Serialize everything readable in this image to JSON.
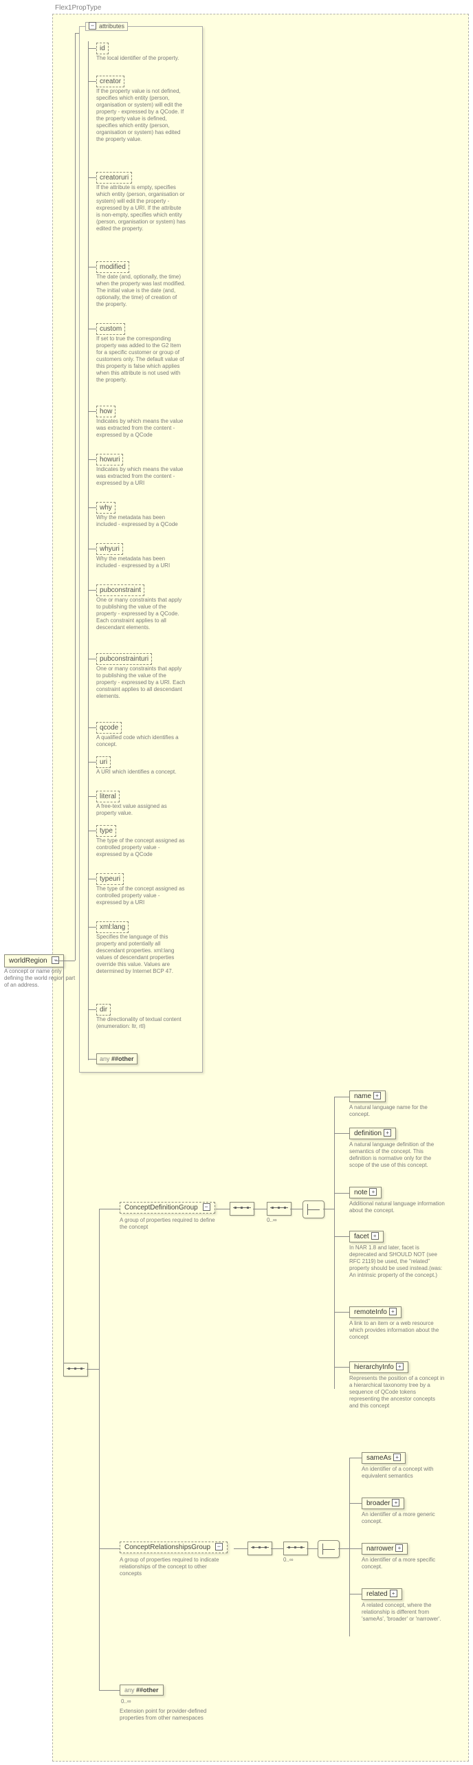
{
  "typeLabel": "Flex1PropType",
  "rootElement": {
    "name": "worldRegion",
    "desc": "A concept or name only defining the world region part of an address."
  },
  "attributesLabel": "attributes",
  "attributes": [
    {
      "name": "id",
      "desc": "The local identifier of the property."
    },
    {
      "name": "creator",
      "desc": "If the property value is not defined, specifies which entity (person, organisation or system) will edit the property - expressed by a QCode. If the property value is defined, specifies which entity (person, organisation or system) has edited the property value."
    },
    {
      "name": "creatoruri",
      "desc": "If the attribute is empty, specifies which entity (person, organisation or system) will edit the property - expressed by a URI. If the attribute is non-empty, specifies which entity (person, organisation or system) has edited the property."
    },
    {
      "name": "modified",
      "desc": "The date (and, optionally, the time) when the property was last modified. The initial value is the date (and, optionally, the time) of creation of the property."
    },
    {
      "name": "custom",
      "desc": "If set to true the corresponding property was added to the G2 Item for a specific customer or group of customers only. The default value of this property is false which applies when this attribute is not used with the property."
    },
    {
      "name": "how",
      "desc": "Indicates by which means the value was extracted from the content - expressed by a QCode"
    },
    {
      "name": "howuri",
      "desc": "Indicates by which means the value was extracted from the content - expressed by a URI"
    },
    {
      "name": "why",
      "desc": "Why the metadata has been included - expressed by a QCode"
    },
    {
      "name": "whyuri",
      "desc": "Why the metadata has been included - expressed by a URI"
    },
    {
      "name": "pubconstraint",
      "desc": "One or many constraints that apply to publishing the value of the property - expressed by a QCode. Each constraint applies to all descendant elements."
    },
    {
      "name": "pubconstrainturi",
      "desc": "One or many constraints that apply to publishing the value of the property - expressed by a URI. Each constraint applies to all descendant elements."
    },
    {
      "name": "qcode",
      "desc": "A qualified code which identifies a concept."
    },
    {
      "name": "uri",
      "desc": "A URI which identifies a concept."
    },
    {
      "name": "literal",
      "desc": "A free-text value assigned as property value."
    },
    {
      "name": "type",
      "desc": "The type of the concept assigned as controlled property value - expressed by a QCode"
    },
    {
      "name": "typeuri",
      "desc": "The type of the concept assigned as controlled property value - expressed by a URI"
    },
    {
      "name": "xml:lang",
      "desc": "Specifies the language of this property and potentially all descendant properties. xml:lang values of descendant properties override this value. Values are determined by Internet BCP 47."
    },
    {
      "name": "dir",
      "desc": "The directionality of textual content (enumeration: ltr, rtl)"
    }
  ],
  "attrWildcard": {
    "label": "any ##other"
  },
  "groups": {
    "definition": {
      "name": "ConceptDefinitionGroup",
      "desc": "A group of properties required to define the concept"
    },
    "relationships": {
      "name": "ConceptRelationshipsGroup",
      "desc": "A group of properties required to indicate relationships of the concept to other concepts"
    }
  },
  "defChildren": [
    {
      "name": "name",
      "desc": "A natural language name for the concept."
    },
    {
      "name": "definition",
      "desc": "A natural language definition of the semantics of the concept. This definition is normative only for the scope of the use of this concept."
    },
    {
      "name": "note",
      "desc": "Additional natural language information about the concept."
    },
    {
      "name": "facet",
      "desc": "In NAR 1.8 and later, facet is deprecated and SHOULD NOT (see RFC 2119) be used, the \"related\" property should be used instead.(was: An intrinsic property of the concept.)"
    },
    {
      "name": "remoteInfo",
      "desc": "A link to an item or a web resource which provides information about the concept"
    },
    {
      "name": "hierarchyInfo",
      "desc": "Represents the position of a concept in a hierarchical taxonomy tree by a sequence of QCode tokens representing the ancestor concepts and this concept"
    }
  ],
  "relChildren": [
    {
      "name": "sameAs",
      "desc": "An identifier of a concept with equivalent semantics"
    },
    {
      "name": "broader",
      "desc": "An identifier of a more generic concept."
    },
    {
      "name": "narrower",
      "desc": "An identifier of a more specific concept."
    },
    {
      "name": "related",
      "desc": "A related concept, where the relationship is different from 'sameAs', 'broader' or 'narrower'."
    }
  ],
  "bottomAny": {
    "label": "any ##other",
    "desc": "Extension point for provider-defined properties from other namespaces"
  },
  "occ": {
    "zeroInf": "0..∞",
    "zeroInfRep": "0..∞"
  }
}
